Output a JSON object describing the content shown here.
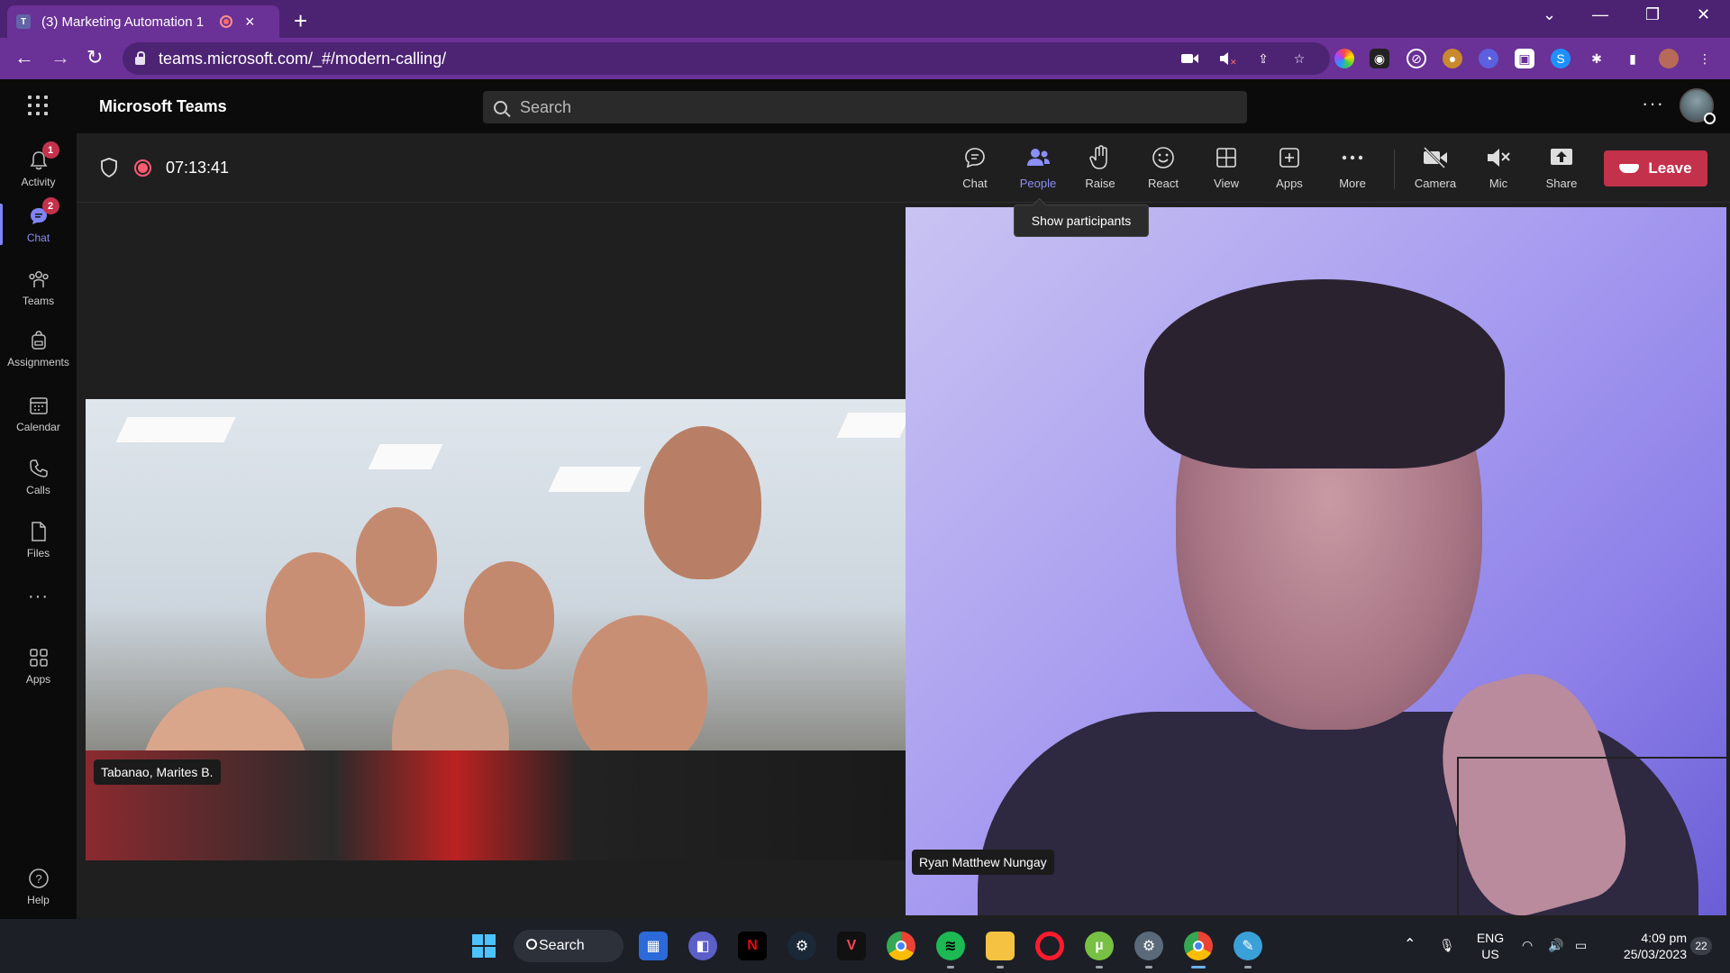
{
  "browser": {
    "tab_title": "(3) Marketing Automation 1",
    "tab_app_icon": "T",
    "url": "teams.microsoft.com/_#/modern-calling/",
    "new_tab_label": "+"
  },
  "teams": {
    "app_name": "Microsoft Teams",
    "search_placeholder": "Search",
    "more_label": "···"
  },
  "rail": {
    "items": [
      {
        "label": "Activity",
        "badge": "1"
      },
      {
        "label": "Chat",
        "badge": "2"
      },
      {
        "label": "Teams"
      },
      {
        "label": "Assignments"
      },
      {
        "label": "Calendar"
      },
      {
        "label": "Calls"
      },
      {
        "label": "Files"
      },
      {
        "label": "···"
      },
      {
        "label": "Apps"
      },
      {
        "label": "Help"
      }
    ]
  },
  "meeting": {
    "timer": "07:13:41",
    "toolbar": {
      "chat": "Chat",
      "people": "People",
      "raise": "Raise",
      "react": "React",
      "view": "View",
      "apps": "Apps",
      "more": "More",
      "camera": "Camera",
      "mic": "Mic",
      "share": "Share",
      "leave": "Leave"
    },
    "tooltip": "Show participants",
    "participants": [
      {
        "name": "Tabanao, Marites B."
      },
      {
        "name": "Ryan Matthew Nungay"
      }
    ]
  },
  "taskbar": {
    "search_label": "Search",
    "language": "ENG",
    "region": "US",
    "time": "4:09 pm",
    "date": "25/03/2023",
    "notifications": "22"
  },
  "colors": {
    "browser_tab": "#6a3196",
    "browser_strip": "#4c2372",
    "teams_accent": "#8b8ff7",
    "leave_red": "#c4314b",
    "badge_red": "#c4314b"
  }
}
